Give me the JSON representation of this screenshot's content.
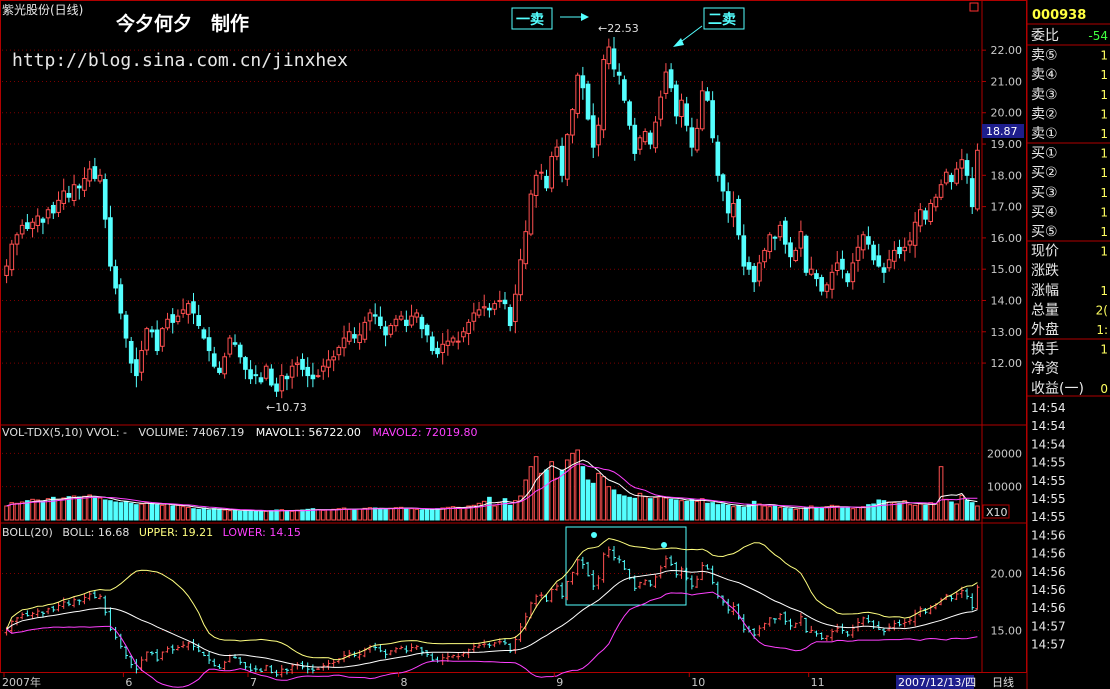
{
  "stock_title": "紫光股份(日线)",
  "author_caption": "今夕何夕　制作",
  "blog_url": "http://blog.sina.com.cn/jinxhex",
  "code_display": "000938",
  "colors": {
    "up": "#ff5050",
    "down": "#54ffff",
    "grid": "#7a0000",
    "border": "#b00000",
    "axis_text": "#c8c8c8",
    "ma1": "#ffffff",
    "ma2": "#ff40ff",
    "mid": "#ffff80",
    "upper_line": "#ffff80",
    "lower_line": "#ff40ff",
    "boll_mid": "#ffffff",
    "box": "#54ffff",
    "price_box_bg": "#1e1e8c"
  },
  "main_panel": {
    "high_label": "22.53",
    "low_label": "10.73",
    "current_price_tag": "18.87",
    "annotations": [
      {
        "text": "一卖",
        "pointer": "arrow-right"
      },
      {
        "text": "二卖",
        "pointer": "arrow-down-left"
      }
    ]
  },
  "volume_panel": {
    "header_name": "VOL-TDX(5,10) VVOL: -",
    "header_volume": "VOLUME: 74067.19",
    "header_mavol1": "MAVOL1: 56722.00",
    "header_mavol2": "MAVOL2: 72019.80",
    "scale_tag": "X10"
  },
  "boll_panel": {
    "header_name": "BOLL(20)",
    "header_boll": "BOLL: 16.68",
    "header_upper": "UPPER: 19.21",
    "header_lower": "LOWER: 14.15"
  },
  "x_axis": {
    "labels": [
      "2007年",
      "6",
      "7",
      "8",
      "9",
      "10",
      "11"
    ],
    "date_highlight": "2007/12/13/四",
    "period": "日线"
  },
  "quote_panel": {
    "rows": [
      {
        "label": "委比",
        "value": "-54"
      },
      {
        "label": "卖⑤",
        "value": "1"
      },
      {
        "label": "卖④",
        "value": "1"
      },
      {
        "label": "卖③",
        "value": "1"
      },
      {
        "label": "卖②",
        "value": "1"
      },
      {
        "label": "卖①",
        "value": "1"
      },
      {
        "label": "买①",
        "value": "1"
      },
      {
        "label": "买②",
        "value": "1"
      },
      {
        "label": "买③",
        "value": "1"
      },
      {
        "label": "买④",
        "value": "1"
      },
      {
        "label": "买⑤",
        "value": "1"
      },
      {
        "label": "现价",
        "value": "1"
      },
      {
        "label": "涨跌",
        "value": ""
      },
      {
        "label": "涨幅",
        "value": "1"
      },
      {
        "label": "总量",
        "value": "2("
      },
      {
        "label": "外盘",
        "value": "1:"
      },
      {
        "label": "换手",
        "value": "1"
      },
      {
        "label": "净资",
        "value": ""
      },
      {
        "label": "收益(一)",
        "value": "0"
      }
    ],
    "times": [
      "14:54",
      "14:54",
      "14:54",
      "14:55",
      "14:55",
      "14:55",
      "14:55",
      "14:56",
      "14:56",
      "14:56",
      "14:56",
      "14:56",
      "14:57",
      "14:57"
    ]
  },
  "chart_data": {
    "type": "candlestick",
    "title": "紫光股份(日线)",
    "main_axis": {
      "ylim": [
        10.5,
        22.9
      ],
      "ticks": [
        12.0,
        13.0,
        14.0,
        15.0,
        16.0,
        17.0,
        18.0,
        19.0,
        20.0,
        21.0,
        22.0
      ]
    },
    "volume_axis": {
      "ylim": [
        0,
        24000
      ],
      "ticks": [
        10000,
        20000
      ]
    },
    "boll_axis": {
      "ylim": [
        11.7,
        24.0
      ],
      "ticks": [
        15.0,
        20.0
      ]
    },
    "close": [
      15.1,
      15.8,
      16.1,
      16.4,
      16.3,
      16.5,
      16.7,
      16.5,
      16.9,
      16.8,
      17.2,
      17.5,
      17.3,
      17.7,
      17.6,
      17.9,
      18.2,
      17.9,
      18.0,
      16.6,
      15.1,
      14.4,
      13.6,
      12.8,
      12.0,
      11.6,
      12.4,
      13.1,
      13.0,
      12.4,
      13.1,
      13.4,
      13.3,
      13.5,
      13.7,
      13.9,
      13.6,
      13.2,
      12.8,
      12.4,
      11.9,
      11.7,
      12.2,
      12.8,
      12.6,
      12.2,
      11.8,
      11.5,
      11.6,
      11.4,
      11.9,
      11.3,
      11.1,
      11.6,
      11.5,
      11.9,
      12.0,
      11.8,
      11.6,
      11.5,
      11.6,
      11.9,
      12.1,
      12.2,
      12.5,
      12.8,
      13.0,
      12.8,
      12.9,
      13.3,
      13.6,
      13.5,
      13.2,
      12.9,
      13.2,
      13.4,
      13.5,
      13.2,
      13.5,
      13.6,
      13.1,
      12.9,
      12.4,
      12.3,
      12.6,
      12.7,
      12.8,
      12.7,
      13.0,
      13.3,
      13.6,
      13.7,
      13.8,
      13.7,
      13.9,
      14.0,
      13.9,
      13.2,
      14.2,
      15.3,
      16.2,
      17.4,
      18.0,
      18.1,
      17.6,
      18.6,
      18.9,
      18.0,
      19.3,
      20.1,
      21.2,
      20.8,
      19.8,
      18.9,
      19.6,
      21.7,
      22.1,
      21.4,
      21.2,
      20.4,
      19.6,
      18.7,
      19.2,
      19.4,
      19.0,
      19.7,
      20.5,
      21.3,
      20.8,
      19.9,
      20.4,
      19.6,
      18.9,
      19.5,
      20.7,
      20.4,
      19.2,
      18.0,
      17.5,
      16.8,
      17.1,
      16.1,
      15.1,
      15.0,
      14.6,
      15.2,
      15.6,
      16.1,
      16.0,
      16.4,
      15.8,
      15.4,
      15.6,
      16.2,
      14.9,
      15.0,
      14.7,
      14.3,
      14.5,
      14.9,
      15.2,
      15.0,
      14.6,
      15.2,
      15.7,
      16.1,
      15.8,
      15.3,
      15.1,
      14.9,
      15.3,
      15.6,
      15.5,
      15.7,
      15.9,
      16.5,
      16.9,
      16.6,
      17.1,
      17.3,
      17.7,
      18.1,
      17.8,
      18.2,
      18.5,
      18.0,
      17.0,
      18.8
    ],
    "volume": [
      4200,
      5200,
      5000,
      5400,
      5800,
      6200,
      6000,
      5600,
      6400,
      6800,
      6200,
      6600,
      7000,
      7200,
      6900,
      7100,
      7500,
      6800,
      6600,
      6000,
      5800,
      5400,
      5200,
      5600,
      5000,
      4600,
      4800,
      5200,
      5000,
      4600,
      4400,
      4800,
      4200,
      4400,
      4000,
      3800,
      3400,
      3200,
      3600,
      3000,
      3400,
      3200,
      3000,
      2800,
      3000,
      2600,
      2800,
      3000,
      2700,
      2500,
      2600,
      2800,
      3000,
      3100,
      2800,
      2600,
      2900,
      3000,
      3200,
      3400,
      3100,
      2900,
      3000,
      3200,
      3400,
      3600,
      3200,
      3000,
      3300,
      3500,
      3700,
      3600,
      3400,
      3200,
      3500,
      3700,
      3800,
      3600,
      3400,
      3200,
      3000,
      3300,
      3100,
      3400,
      3600,
      3800,
      4000,
      3800,
      3600,
      4200,
      4400,
      5000,
      5600,
      6800,
      4200,
      5200,
      6400,
      4400,
      5800,
      7200,
      12000,
      16000,
      19000,
      14000,
      15000,
      17500,
      12500,
      15000,
      18000,
      20000,
      21000,
      16000,
      12000,
      11000,
      14000,
      13000,
      10000,
      9000,
      7600,
      7200,
      6800,
      6500,
      8000,
      7000,
      6400,
      6800,
      7000,
      6600,
      6200,
      6000,
      5800,
      5600,
      6200,
      5600,
      6400,
      5000,
      5200,
      4600,
      4800,
      4400,
      4000,
      4200,
      3800,
      4600,
      5600,
      4800,
      4200,
      4000,
      4400,
      3800,
      3600,
      3400,
      3200,
      3600,
      3800,
      4200,
      3800,
      3600,
      4000,
      4400,
      4200,
      3800,
      3600,
      3400,
      3800,
      4000,
      4600,
      4800,
      6000,
      5800,
      5400,
      5200,
      5000,
      5800,
      4600,
      4400,
      4800,
      4400,
      5200,
      4800,
      16000,
      6200,
      5400,
      4800,
      7400,
      6000,
      5200,
      4200
    ],
    "ma_volume_1_last": 56722.0,
    "ma_volume_2_last": 72019.8,
    "boll_last": {
      "boll": 16.68,
      "upper": 19.21,
      "lower": 14.15
    },
    "high_marker": 22.53,
    "low_marker": 10.73,
    "last_price": 18.87
  }
}
